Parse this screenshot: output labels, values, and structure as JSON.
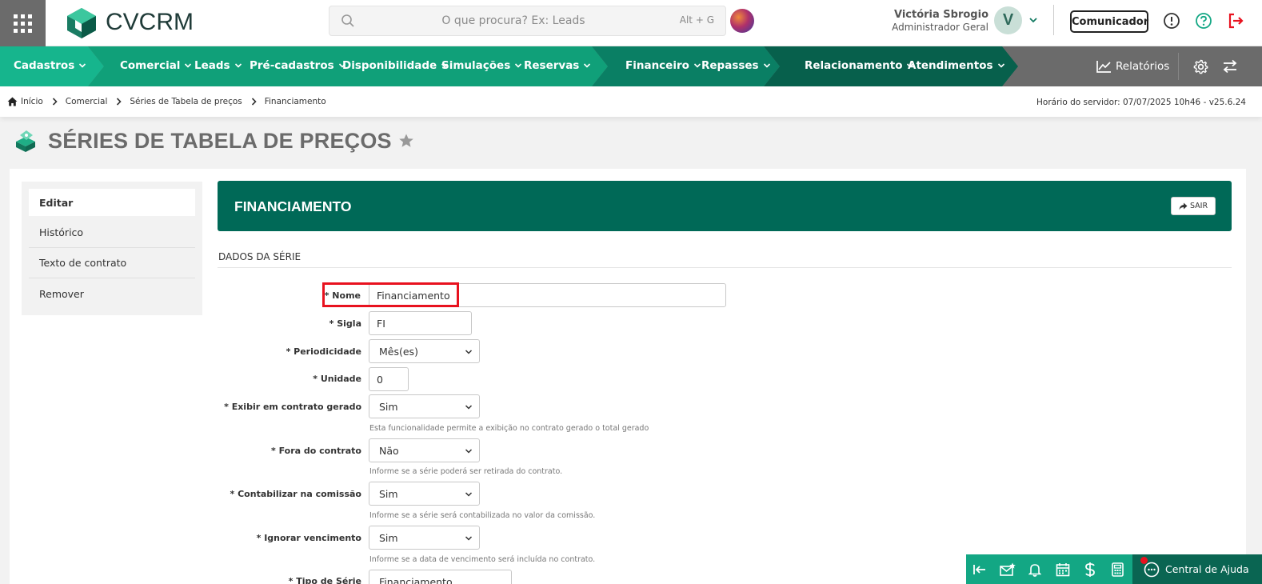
{
  "topbar": {
    "logo_text": "CVCRM",
    "search_placeholder": "O que procura? Ex: Leads",
    "search_shortcut": "Alt + G",
    "user_name": "Victória Sbrogio",
    "user_role": "Administrador Geral",
    "avatar_initial": "V",
    "comunicador_label": "Comunicador"
  },
  "nav": {
    "items": [
      {
        "label": "Cadastros"
      },
      {
        "label": "Comercial"
      },
      {
        "label": "Leads"
      },
      {
        "label": "Pré-cadastros"
      },
      {
        "label": "Disponibilidade"
      },
      {
        "label": "Simulações"
      },
      {
        "label": "Reservas"
      },
      {
        "label": "Financeiro"
      },
      {
        "label": "Repasses"
      },
      {
        "label": "Relacionamento"
      },
      {
        "label": "Atendimentos"
      }
    ],
    "reports_label": "Relatórios"
  },
  "breadcrumb": {
    "items": [
      "Início",
      "Comercial",
      "Séries de Tabela de preços",
      "Financiamento"
    ],
    "server_time": "Horário do servidor: 07/07/2025 10h46 - v25.6.24"
  },
  "page": {
    "title": "SÉRIES DE TABELA DE PREÇOS"
  },
  "sidemenu": {
    "items": [
      "Editar",
      "Histórico",
      "Texto de contrato",
      "Remover"
    ]
  },
  "form": {
    "header_title": "FINANCIAMENTO",
    "sair_label": "SAIR",
    "section_title": "DADOS DA SÉRIE",
    "fields": {
      "nome": {
        "label": "* Nome",
        "value": "Financiamento"
      },
      "sigla": {
        "label": "* Sigla",
        "value": "FI"
      },
      "periodicidade": {
        "label": "* Periodicidade",
        "value": "Mês(es)"
      },
      "unidade": {
        "label": "* Unidade",
        "value": "0"
      },
      "exibir": {
        "label": "* Exibir em contrato gerado",
        "value": "Sim",
        "help": "Esta funcionalidade permite a exibição no contrato gerado o total gerado"
      },
      "fora": {
        "label": "* Fora do contrato",
        "value": "Não",
        "help": "Informe se a série poderá ser retirada do contrato."
      },
      "contabilizar": {
        "label": "* Contabilizar na comissão",
        "value": "Sim",
        "help": "Informe se a série será contabilizada no valor da comissão."
      },
      "ignorar": {
        "label": "* Ignorar vencimento",
        "value": "Sim",
        "help": "Informe se a data de vencimento será incluída no contrato."
      },
      "tipo": {
        "label": "* Tipo de Série",
        "value": "Financiamento"
      }
    }
  },
  "bottombar": {
    "help_label": "Central de Ajuda"
  },
  "colors": {
    "brand_green": "#16b58d",
    "dark_green": "#006957",
    "nav_gray": "#6b6b6b",
    "highlight_red": "#e8121f"
  }
}
